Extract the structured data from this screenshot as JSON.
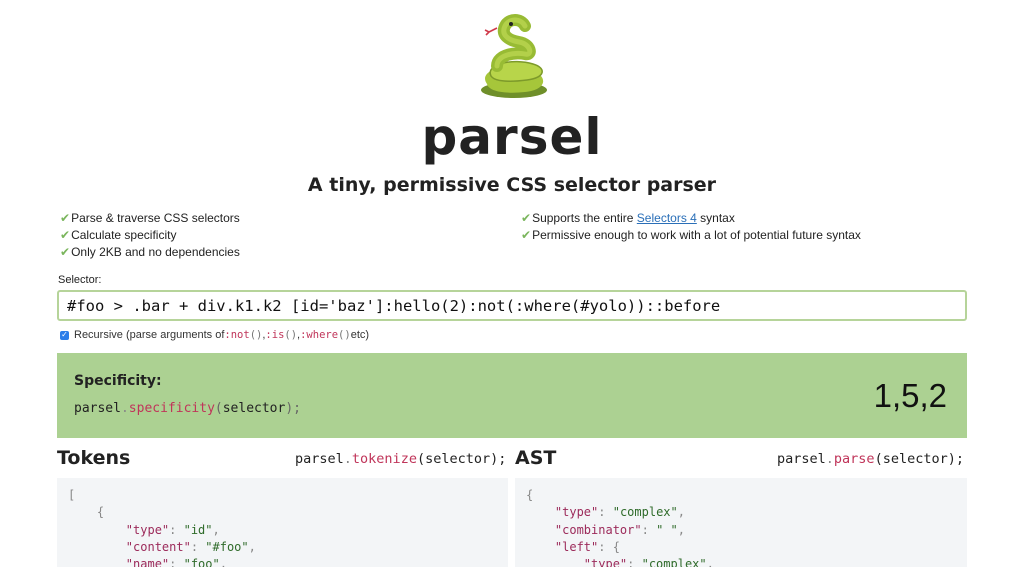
{
  "header": {
    "title": "parsel",
    "subtitle": "A tiny, permissive CSS selector parser"
  },
  "features": {
    "left": [
      {
        "check": "✔",
        "text": "Parse & traverse CSS selectors"
      },
      {
        "check": "✔",
        "text": "Calculate specificity"
      },
      {
        "check": "✔",
        "text": "Only 2KB and no dependencies"
      }
    ],
    "right": [
      {
        "check": "✔",
        "before": "Supports the entire ",
        "link": "Selectors 4",
        "after": " syntax"
      },
      {
        "check": "✔",
        "text": "Permissive enough to work with a lot of potential future syntax"
      }
    ]
  },
  "selector": {
    "label": "Selector:",
    "value": "#foo > .bar + div.k1.k2 [id='baz']:hello(2):not(:where(#yolo))::before"
  },
  "recursive": {
    "checked": true,
    "check_glyph": "✓",
    "prefix": "Recursive (parse arguments of ",
    "fn1": ":not",
    "fn2": ":is",
    "fn3": ":where",
    "parens": "()",
    "sep": ", ",
    "suffix": " etc)"
  },
  "specificity": {
    "heading": "Specificity:",
    "code_obj": "parsel",
    "code_dot": ".",
    "code_fn": "specificity",
    "code_open": "(",
    "code_arg": "selector",
    "code_close": ");",
    "value": "1,5,2"
  },
  "tokens": {
    "title": "Tokens",
    "call_obj": "parsel",
    "call_dot": ".",
    "call_fn": "tokenize",
    "call_args": "(selector);",
    "lines": [
      {
        "indent": "",
        "key": "",
        "val": "",
        "raw": "["
      },
      {
        "indent": "    ",
        "key": "",
        "val": "",
        "raw": "{"
      },
      {
        "indent": "        ",
        "key": "\"type\"",
        "sep": ": ",
        "val": "\"id\"",
        "tail": ","
      },
      {
        "indent": "        ",
        "key": "\"content\"",
        "sep": ": ",
        "val": "\"#foo\"",
        "tail": ","
      },
      {
        "indent": "        ",
        "key": "\"name\"",
        "sep": ": ",
        "val": "\"foo\"",
        "tail": ","
      }
    ]
  },
  "ast": {
    "title": "AST",
    "call_obj": "parsel",
    "call_dot": ".",
    "call_fn": "parse",
    "call_args": "(selector);",
    "lines": [
      {
        "indent": "",
        "key": "",
        "val": "",
        "raw": "{"
      },
      {
        "indent": "    ",
        "key": "\"type\"",
        "sep": ": ",
        "val": "\"complex\"",
        "tail": ","
      },
      {
        "indent": "    ",
        "key": "\"combinator\"",
        "sep": ": ",
        "val": "\" \"",
        "tail": ","
      },
      {
        "indent": "    ",
        "key": "\"left\"",
        "sep": ": ",
        "val": "",
        "tail": "{"
      },
      {
        "indent": "        ",
        "key": "\"type\"",
        "sep": ": ",
        "val": "\"complex\"",
        "tail": ","
      }
    ]
  },
  "colors": {
    "accent_green": "#acd192",
    "input_border": "#b6d49a",
    "fn_pink": "#c0355a",
    "check_green": "#7ab55c",
    "checkbox_blue": "#2b7de9"
  }
}
